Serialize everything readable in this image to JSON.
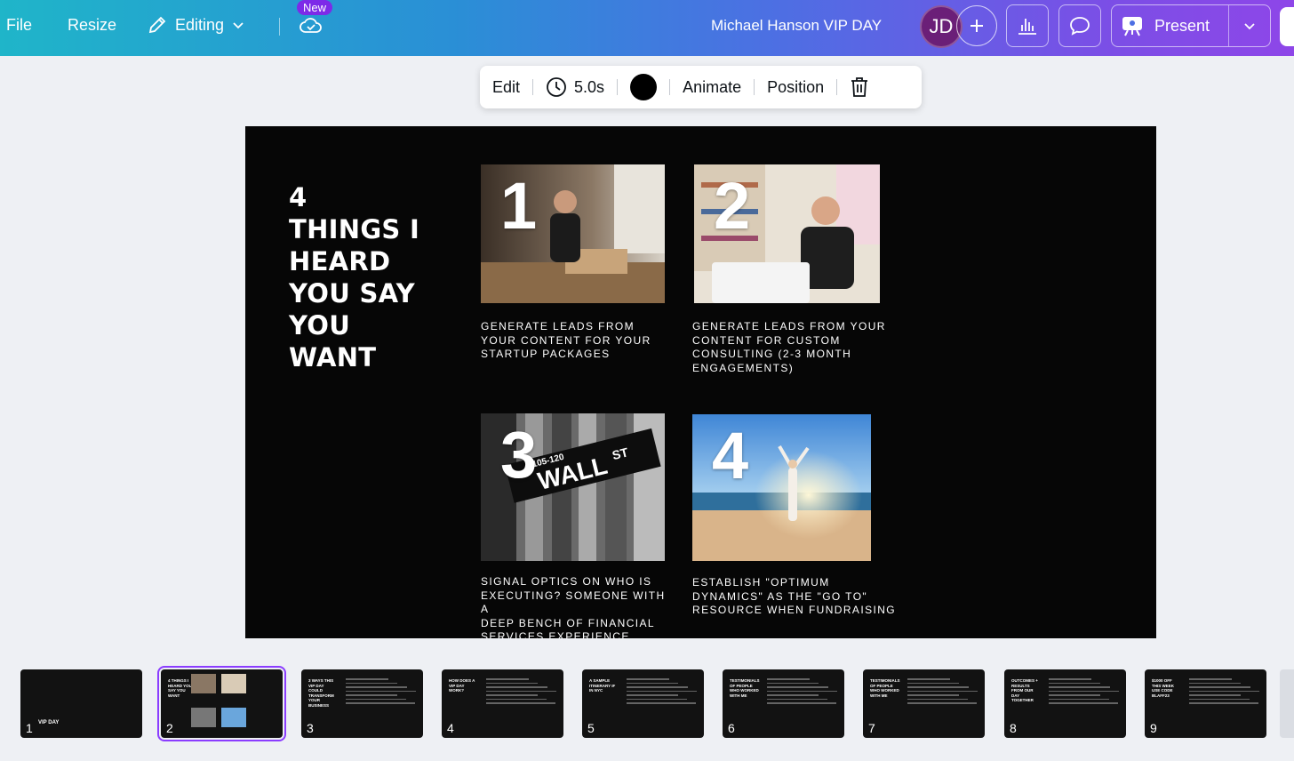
{
  "topbar": {
    "file": "File",
    "resize": "Resize",
    "editing": "Editing",
    "new_badge": "New",
    "doc_title": "Michael Hanson VIP DAY",
    "avatar_initials": "JD",
    "present": "Present"
  },
  "float_toolbar": {
    "edit": "Edit",
    "duration": "5.0s",
    "color": "#000000",
    "animate": "Animate",
    "position": "Position"
  },
  "slide": {
    "heading_lines": [
      "4",
      "THINGS I",
      "HEARD",
      "YOU SAY",
      "YOU",
      "WANT"
    ],
    "items": [
      {
        "number": "1",
        "caption_lines": [
          "GENERATE LEADS FROM",
          "YOUR CONTENT FOR YOUR",
          "STARTUP PACKAGES"
        ]
      },
      {
        "number": "2",
        "caption_lines": [
          "GENERATE LEADS FROM YOUR",
          "CONTENT FOR CUSTOM",
          "CONSULTING  (2-3 MONTH",
          "ENGAGEMENTS)"
        ]
      },
      {
        "number": "3",
        "caption_lines": [
          "SIGNAL OPTICS ON WHO IS",
          "EXECUTING? SOMEONE WITH A",
          "DEEP BENCH OF FINANCIAL",
          "SERVICES EXPERIENCE"
        ],
        "sign_main": "WALL",
        "sign_st": "ST",
        "sign_small": "105-120"
      },
      {
        "number": "4",
        "caption_lines": [
          "ESTABLISH \"OPTIMUM",
          "DYNAMICS\"  AS THE \"GO TO\"",
          "RESOURCE WHEN FUNDRAISING"
        ]
      }
    ]
  },
  "filmstrip": [
    {
      "num": "1",
      "label": "VIP DAY"
    },
    {
      "num": "2",
      "label": "4 THINGS I HEARD YOU SAY YOU WANT"
    },
    {
      "num": "3",
      "label": "3 WAYS THIS VIP DAY COULD TRANSFORM YOUR BUSINESS"
    },
    {
      "num": "4",
      "label": "HOW DOES A VIP DAY WORK?"
    },
    {
      "num": "5",
      "label": "A SAMPLE ITINERARY IF IN NYC"
    },
    {
      "num": "6",
      "label": "TESTIMONIALS OF PEOPLE WHO WORKED WITH ME"
    },
    {
      "num": "7",
      "label": "TESTIMONIALS OF PEOPLE WHO WORKED WITH ME"
    },
    {
      "num": "8",
      "label": "OUTCOMES + RESULTS FROM OUR DAY TOGETHER"
    },
    {
      "num": "9",
      "label": "$1000 OFF THIS WEEK USE CODE BLAFF23"
    }
  ],
  "icons": {
    "pencil": "pencil-icon",
    "cloud": "cloud-check-icon",
    "plus": "plus-icon",
    "chart": "bar-chart-icon",
    "comment": "comment-icon",
    "present": "present-icon",
    "clock": "clock-icon",
    "trash": "trash-icon"
  }
}
